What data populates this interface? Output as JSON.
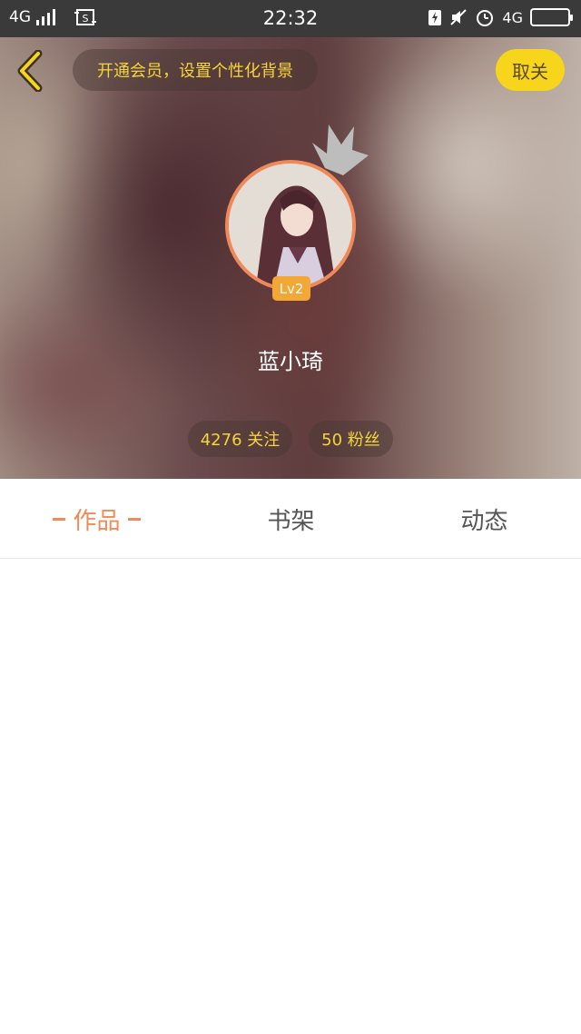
{
  "status_bar": {
    "network_left": "4G",
    "time": "22:32",
    "network_right": "4G"
  },
  "header": {
    "back_icon": "chevron-left-icon",
    "vip_prompt": "开通会员，设置个性化背景",
    "unfollow_label": "取关",
    "level_badge": "Lv2",
    "nickname": "蓝小琦",
    "following": "4276 关注",
    "fans": "50 粉丝"
  },
  "tabs": [
    {
      "label": "作品",
      "active": true
    },
    {
      "label": "书架",
      "active": false
    },
    {
      "label": "动态",
      "active": false
    }
  ],
  "colors": {
    "accent_yellow": "#f7d51c",
    "accent_orange": "#f08a5a",
    "badge_orange": "#f2a736"
  }
}
